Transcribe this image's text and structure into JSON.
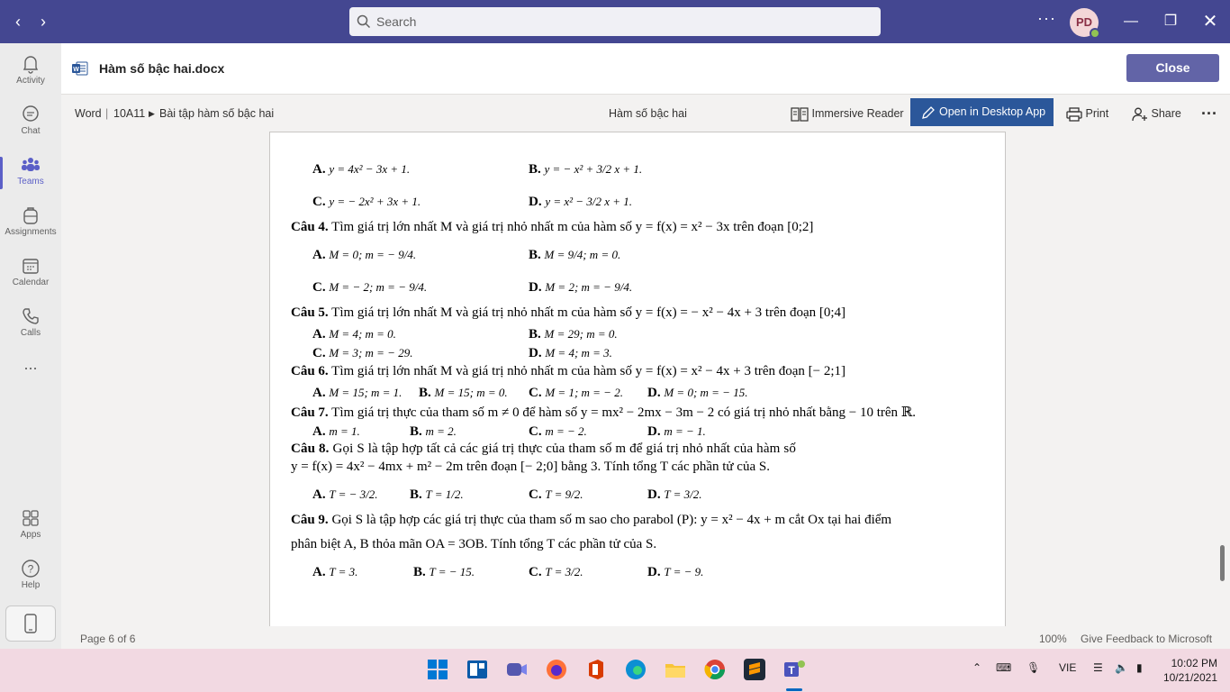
{
  "titlebar": {
    "search_placeholder": "Search",
    "more_label": "···",
    "avatar_initials": "PD"
  },
  "rail": {
    "items": [
      {
        "label": "Activity"
      },
      {
        "label": "Chat"
      },
      {
        "label": "Teams"
      },
      {
        "label": "Assignments"
      },
      {
        "label": "Calendar"
      },
      {
        "label": "Calls"
      },
      {
        "label": "..."
      },
      {
        "label": "Apps"
      },
      {
        "label": "Help"
      }
    ]
  },
  "doc": {
    "filename": "Hàm số bậc hai.docx",
    "close_label": "Close"
  },
  "cmdbar": {
    "breadcrumb_app": "Word",
    "breadcrumb_sep": "|",
    "breadcrumb_class": "10A11",
    "breadcrumb_folder": "Bài tập hàm số bậc hai",
    "center_title": "Hàm số bậc hai",
    "immersive_reader": "Immersive Reader",
    "open_desktop": "Open in Desktop App",
    "print": "Print",
    "share": "Share",
    "more": "···"
  },
  "content": {
    "l1a": "A.",
    "l1a_m": "y = 4x² − 3x + 1.",
    "l1b": "B.",
    "l1b_m": "y = − x² + 3/2 x + 1.",
    "l2a": "C.",
    "l2a_m": "y = − 2x² + 3x + 1.",
    "l2b": "D.",
    "l2b_m": "y = x² − 3/2 x + 1.",
    "q4_label": "Câu 4.",
    "q4_text": "Tìm giá trị lớn nhất M và giá trị nhỏ nhất m của hàm số y = f(x) = x² − 3x trên đoạn [0;2]",
    "q4a": "M = 0; m = − 9/4.",
    "q4b": "M = 9/4; m = 0.",
    "q4c": "M = − 2; m = − 9/4.",
    "q4d": "M = 2; m = − 9/4.",
    "q5_label": "Câu 5.",
    "q5_text": "Tìm giá trị lớn nhất M và giá trị nhỏ nhất m của hàm số y = f(x) = − x² − 4x + 3 trên đoạn [0;4]",
    "q5a": "M = 4; m = 0.",
    "q5b": "M = 29; m = 0.",
    "q5c": "M = 3; m = − 29.",
    "q5d": "M = 4; m = 3.",
    "q6_label": "Câu 6.",
    "q6_text": "Tìm giá trị lớn nhất M và giá trị nhỏ nhất m của hàm số y = f(x) = x² − 4x + 3 trên đoạn [− 2;1]",
    "q6a": "M = 15; m = 1.",
    "q6b": "M = 15; m = 0.",
    "q6c": "M = 1; m = − 2.",
    "q6d": "M = 0; m = − 15.",
    "q7_label": "Câu 7.",
    "q7_text": "Tìm giá trị thực của tham số m ≠ 0 để hàm số y = mx² − 2mx − 3m − 2 có giá trị nhỏ nhất bằng − 10 trên ℝ.",
    "q7a": "m = 1.",
    "q7b": "m = 2.",
    "q7c": "m = − 2.",
    "q7d": "m = − 1.",
    "q8_label": "Câu 8.",
    "q8_text1": "Gọi S là tập hợp tất cả các giá trị thực của tham số m để giá trị nhỏ nhất của hàm số",
    "q8_text2": "y = f(x) = 4x² − 4mx + m² − 2m trên đoạn [− 2;0] bằng 3. Tính tổng T các phần tử của S.",
    "q8a": "T = − 3/2.",
    "q8b": "T = 1/2.",
    "q8c": "T = 9/2.",
    "q8d": "T = 3/2.",
    "q9_label": "Câu 9.",
    "q9_text1": "Gọi S là tập hợp các giá trị thực của tham số m sao cho parabol (P): y = x² − 4x + m cắt Ox tại hai điểm",
    "q9_text2": "phân biệt A, B thỏa mãn OA = 3OB. Tính tổng T các phần tử của S.",
    "q9a": "T = 3.",
    "q9b": "T = − 15.",
    "q9c": "T = 3/2.",
    "q9d": "T = − 9.",
    "opt_a": "A.",
    "opt_b": "B.",
    "opt_c": "C.",
    "opt_d": "D."
  },
  "statusbar": {
    "page": "Page 6 of 6",
    "zoom": "100%",
    "feedback": "Give Feedback to Microsoft"
  },
  "taskbar": {
    "lang": "VIE",
    "time": "10:02 PM",
    "date": "10/21/2021"
  },
  "colors": {
    "titlebar": "#444791",
    "accent": "#6264a7",
    "word_blue": "#2b579a"
  }
}
